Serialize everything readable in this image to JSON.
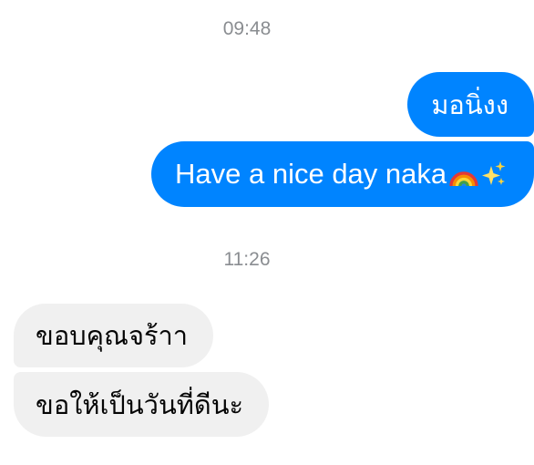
{
  "conversation": {
    "timestamps": [
      "09:48",
      "11:26"
    ],
    "outgoing": [
      {
        "text": "มอนิ่งง"
      },
      {
        "text": "Have a nice day naka",
        "emoji": [
          "rainbow-emoji",
          "sparkles-emoji"
        ]
      }
    ],
    "incoming": [
      {
        "text": "ขอบคุณจร้าา"
      },
      {
        "text": "ขอให้เป็นวันที่ดีนะ"
      }
    ]
  },
  "colors": {
    "outgoing_bubble": "#0084ff",
    "incoming_bubble": "#f0f0f0",
    "timestamp_text": "#8a8d91"
  }
}
